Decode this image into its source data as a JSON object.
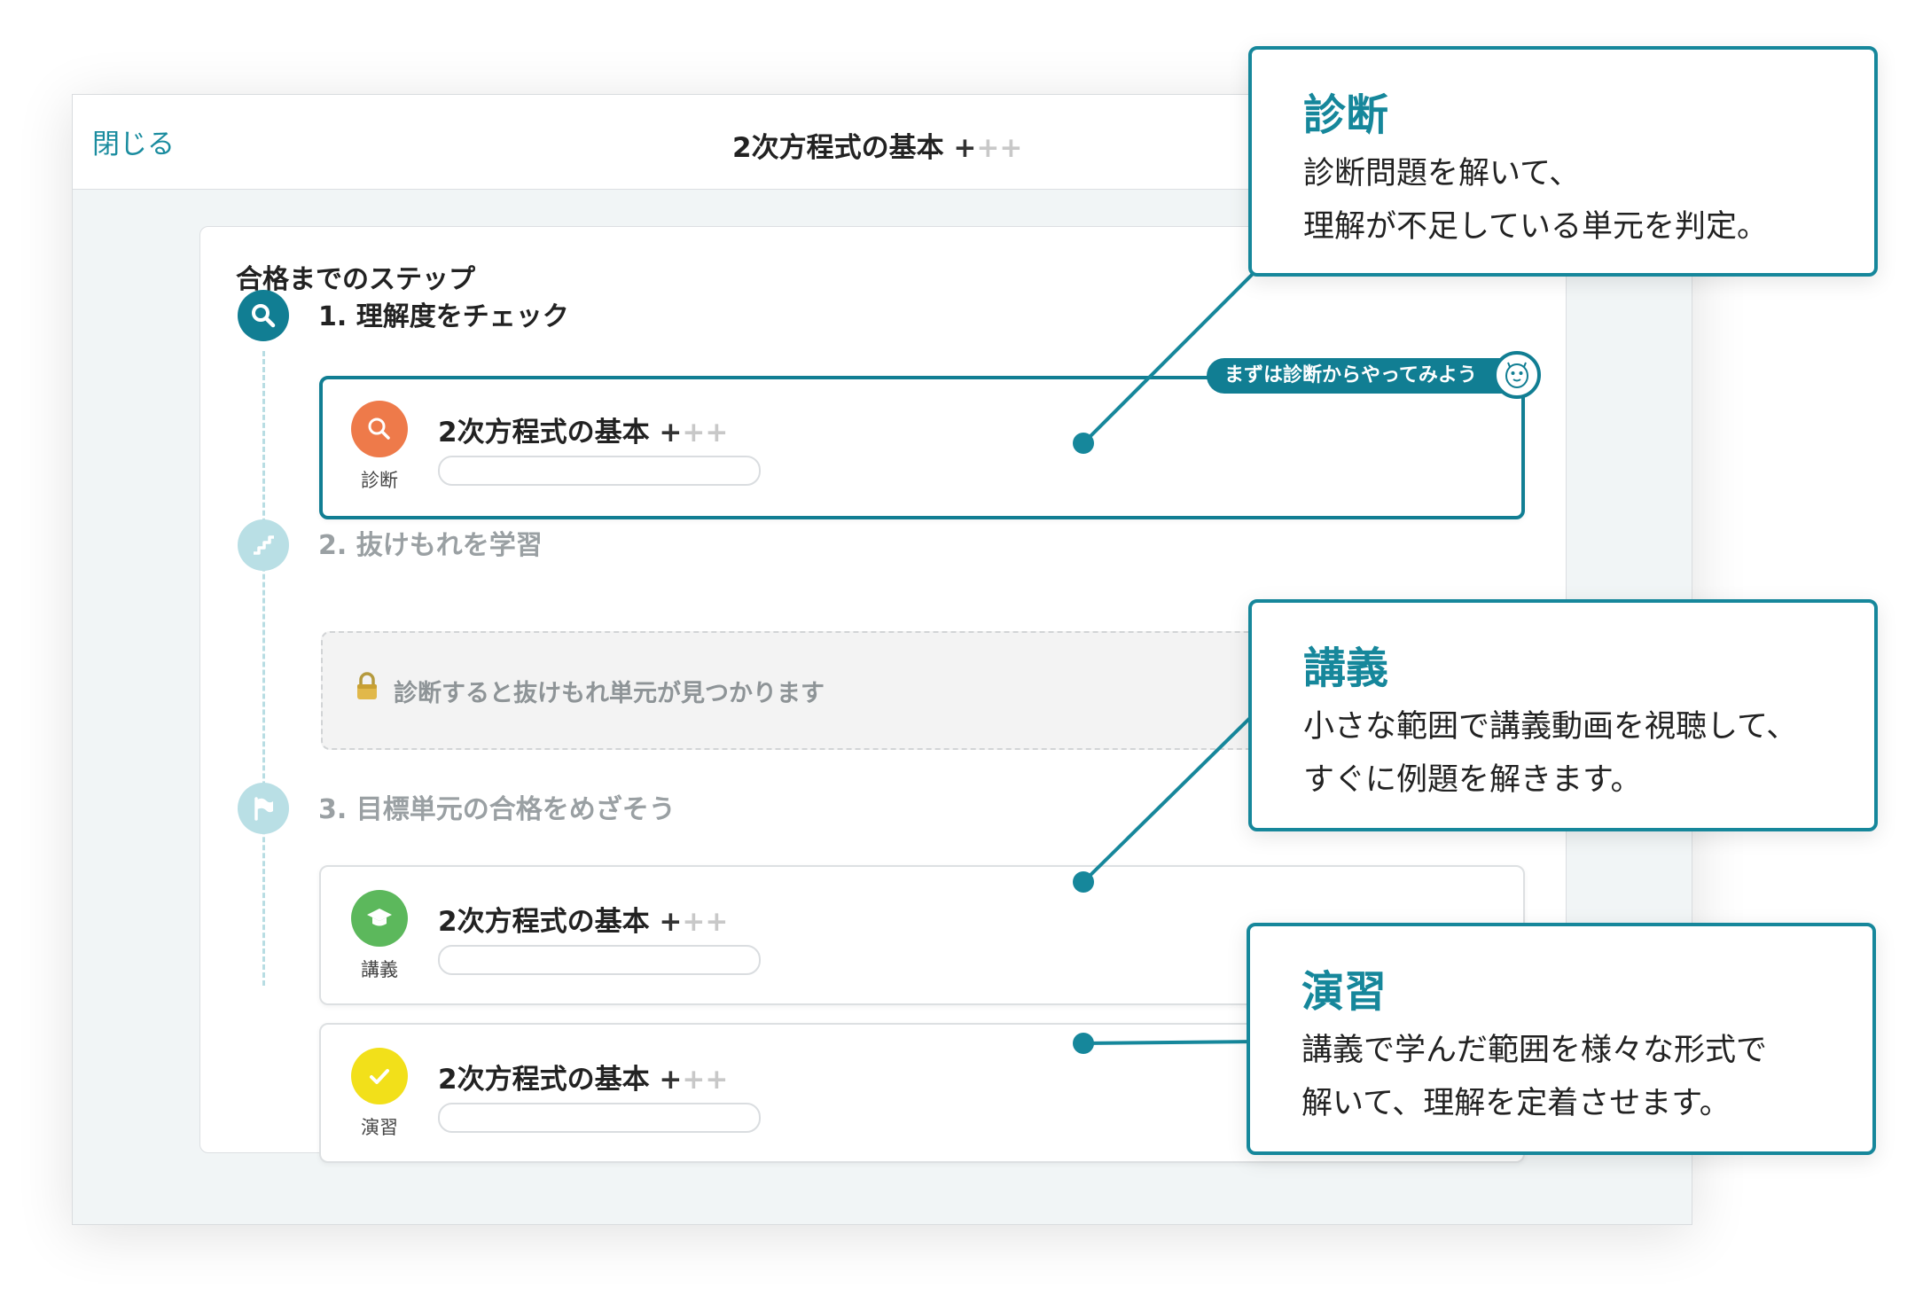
{
  "header": {
    "close_label": "閉じる",
    "title": "2次方程式の基本",
    "plus_active": "+",
    "plus_inactive": "++"
  },
  "steps": {
    "section_title": "合格までのステップ",
    "step1": {
      "label": "1. 理解度をチェック",
      "item": {
        "title": "2次方程式の基本",
        "type": "診断",
        "progress": 0
      },
      "hint": "まずは診断からやってみよう"
    },
    "step2": {
      "label": "2. 抜けもれを学習",
      "locked_message": "診断すると抜けもれ単元が見つかります"
    },
    "step3": {
      "label": "3. 目標単元の合格をめざそう",
      "items": [
        {
          "title": "2次方程式の基本",
          "type": "講義",
          "progress": 0
        },
        {
          "title": "2次方程式の基本",
          "type": "演習",
          "progress": 0
        }
      ]
    }
  },
  "callouts": [
    {
      "title": "診断",
      "lines": [
        "診断問題を解いて、",
        "理解が不足している単元を判定。"
      ]
    },
    {
      "title": "講義",
      "lines": [
        "小さな範囲で講義動画を視聴して、",
        "すぐに例題を解きます。"
      ]
    },
    {
      "title": "演習",
      "lines": [
        "講義で学んだ範囲を様々な形式で",
        "解いて、理解を定着させます。"
      ]
    }
  ],
  "colors": {
    "accent": "#117e93",
    "diagnosis": "#ee7a4a",
    "lecture": "#5cb85c",
    "exercise": "#f2e01a"
  },
  "icons": {
    "step1": "search-icon",
    "step2": "stairs-icon",
    "step3": "flag-icon",
    "diagnosis": "search-icon",
    "lecture": "graduation-cap-icon",
    "exercise": "check-icon",
    "locked": "lock-icon",
    "mascot": "mascot-icon"
  }
}
